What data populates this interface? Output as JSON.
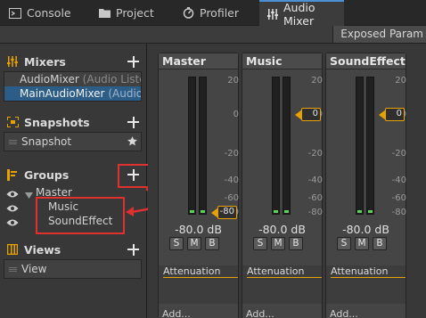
{
  "tabs": [
    {
      "label": "Console",
      "icon": "console-icon"
    },
    {
      "label": "Project",
      "icon": "folder-icon"
    },
    {
      "label": "Profiler",
      "icon": "profiler-icon"
    },
    {
      "label": "Audio Mixer",
      "icon": "audio-mixer-icon",
      "active": true
    }
  ],
  "toolbar": {
    "exposed_params": "Exposed Param"
  },
  "sidebar": {
    "mixers": {
      "title": "Mixers",
      "items": [
        {
          "name": "AudioMixer",
          "suffix": "(Audio Liste"
        },
        {
          "name": "MainAudioMixer",
          "suffix": "(Audio",
          "selected": true
        }
      ]
    },
    "snapshots": {
      "title": "Snapshots",
      "items": [
        "Snapshot"
      ]
    },
    "groups": {
      "title": "Groups",
      "items": [
        {
          "label": "Master",
          "level": 0,
          "expandable": true
        },
        {
          "label": "Music",
          "level": 1
        },
        {
          "label": "SoundEffect",
          "level": 1
        }
      ]
    },
    "views": {
      "title": "Views",
      "items": [
        "View"
      ]
    }
  },
  "scale_labels": [
    "20",
    "0",
    "-20",
    "-40",
    "-60",
    "-80"
  ],
  "strips": [
    {
      "name": "Master",
      "db": "-80.0 dB",
      "fader_value": "-80",
      "buttons": [
        "S",
        "M",
        "B"
      ],
      "effect": "Attenuation",
      "add": "Add..."
    },
    {
      "name": "Music",
      "db": "-80.0 dB",
      "fader_value": "0",
      "buttons": [
        "S",
        "M",
        "B"
      ],
      "effect": "Attenuation",
      "add": "Add..."
    },
    {
      "name": "SoundEffect",
      "db": "-80.0 dB",
      "fader_value": "0",
      "buttons": [
        "S",
        "M",
        "B"
      ],
      "effect": "Attenuation",
      "add": "Add..."
    }
  ],
  "colors": {
    "accent": "#e8a200",
    "selection": "#2c5d87",
    "annotation": "#e03131",
    "meter_level": "#5bd35b",
    "tab_active": "#4d8fd4"
  }
}
